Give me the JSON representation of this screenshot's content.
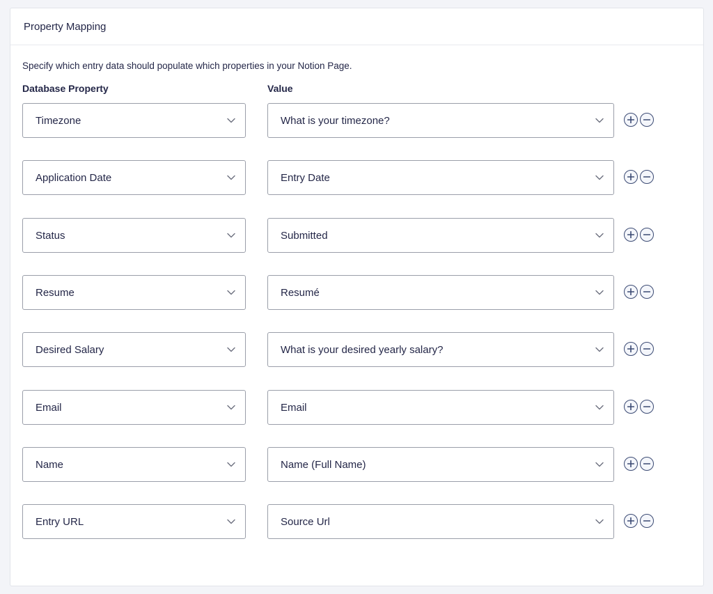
{
  "panel": {
    "title": "Property Mapping",
    "description": "Specify which entry data should populate which properties in your Notion Page.",
    "column_property_label": "Database Property",
    "column_value_label": "Value"
  },
  "mappings": [
    {
      "property": "Timezone",
      "value": "What is your timezone?"
    },
    {
      "property": "Application Date",
      "value": "Entry Date"
    },
    {
      "property": "Status",
      "value": "Submitted"
    },
    {
      "property": "Resume",
      "value": "Resumé"
    },
    {
      "property": "Desired Salary",
      "value": "What is your desired yearly salary?"
    },
    {
      "property": "Email",
      "value": "Email"
    },
    {
      "property": "Name",
      "value": "Name (Full Name)"
    },
    {
      "property": "Entry URL",
      "value": "Source Url"
    }
  ],
  "icons": {
    "dropdown": "chevron-down-icon",
    "add": "plus-circle-icon",
    "remove": "minus-circle-icon"
  },
  "colors": {
    "panel_background": "#ffffff",
    "page_background": "#f3f4f8",
    "text": "#242748",
    "select_border": "#9a9ea9",
    "icon": "#3b4a73"
  }
}
